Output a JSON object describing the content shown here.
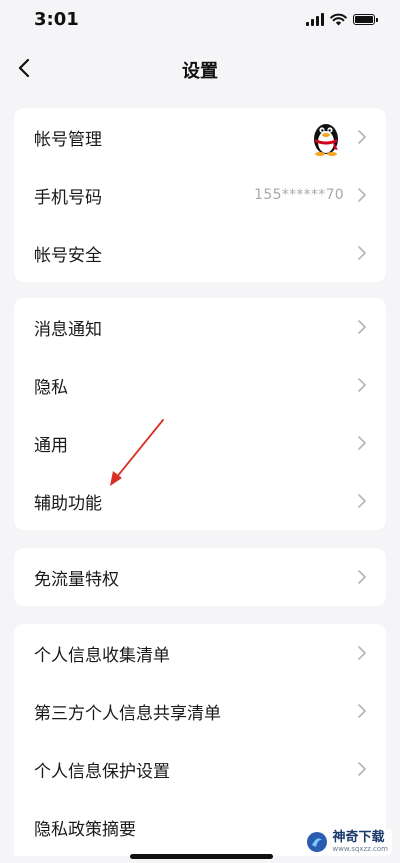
{
  "status": {
    "time": "3:01"
  },
  "nav": {
    "title": "设置"
  },
  "group1": [
    {
      "label": "帐号管理",
      "value": ""
    },
    {
      "label": "手机号码",
      "value": "155******70"
    },
    {
      "label": "帐号安全",
      "value": ""
    }
  ],
  "group2": [
    {
      "label": "消息通知"
    },
    {
      "label": "隐私"
    },
    {
      "label": "通用"
    },
    {
      "label": "辅助功能"
    }
  ],
  "group3": [
    {
      "label": "免流量特权"
    }
  ],
  "group4": [
    {
      "label": "个人信息收集清单"
    },
    {
      "label": "第三方个人信息共享清单"
    },
    {
      "label": "个人信息保护设置"
    },
    {
      "label": "隐私政策摘要"
    }
  ],
  "watermark": {
    "name": "神奇下载",
    "url": "www.sqxzz.com"
  },
  "colors": {
    "background": "#f5f5f7",
    "card": "#ffffff",
    "chevron": "#b5b5ba",
    "arrow": "#d93025"
  }
}
